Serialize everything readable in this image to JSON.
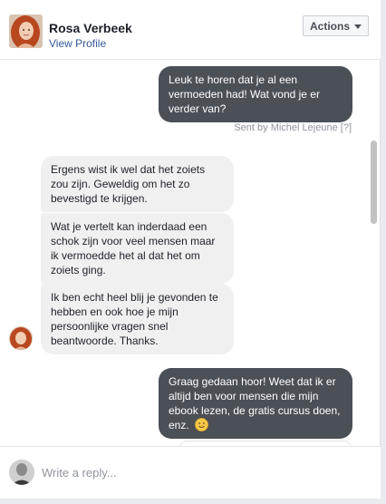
{
  "header": {
    "name": "Rosa Verbeek",
    "profile_link": "View Profile",
    "actions_label": "Actions"
  },
  "messages": [
    {
      "direction": "outgoing",
      "text": "Leuk te horen dat je al een vermoeden had! Wat vond je er verder van?"
    },
    {
      "direction": "incoming",
      "text": "Ergens wist ik wel dat het zoiets zou zijn. Geweldig om het zo bevestigd te krijgen."
    },
    {
      "direction": "incoming",
      "text": "Wat je vertelt kan inderdaad een schok zijn voor veel mensen maar ik vermoedde het al dat het om zoiets ging."
    },
    {
      "direction": "incoming",
      "text": "Ik ben echt heel blij je gevonden te hebben en ook hoe je mijn persoonlijke vragen snel beantwoorde. Thanks."
    },
    {
      "direction": "outgoing",
      "text": "Graag gedaan hoor! Weet dat ik er altijd ben voor mensen die mijn ebook lezen, de gratis cursus doen, enz.",
      "emoji": "smiley-icon"
    }
  ],
  "sent_by": {
    "text": "Sent by Michel Lejeune",
    "help": "[?]"
  },
  "composer": {
    "placeholder": "Write a reply..."
  },
  "colors": {
    "outgoing_bubble": "#4b4f56",
    "incoming_bubble": "#f1f0f0",
    "link": "#365899",
    "muted": "#90949c"
  }
}
